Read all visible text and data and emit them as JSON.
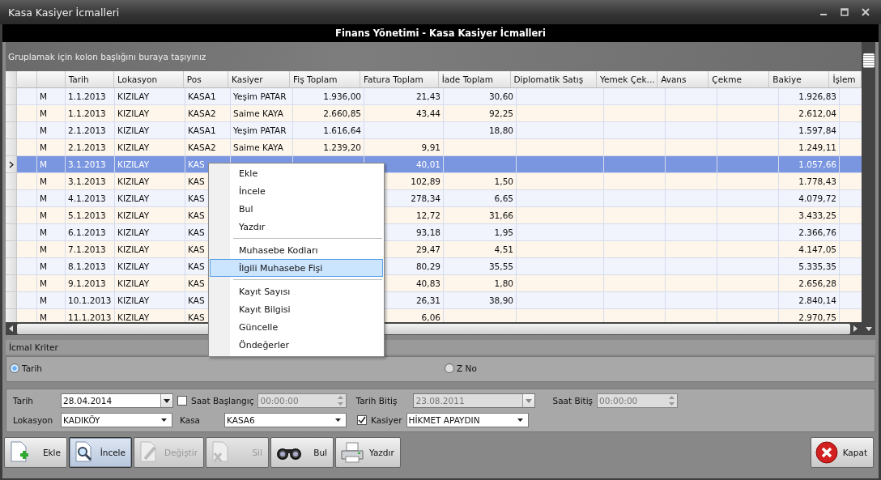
{
  "window": {
    "title": "Kasa Kasiyer İcmalleri"
  },
  "header": "Finans Yönetimi - Kasa Kasiyer İcmalleri",
  "group_panel_hint": "Gruplamak için kolon başlığını buraya taşıyınız",
  "table": {
    "columns": [
      null,
      "Tarih",
      "Lokasyon",
      "Pos",
      "Kasiyer",
      "Fiş Toplam",
      "Fatura Toplam",
      "İade Toplam",
      "Diplomatik Satış",
      "Yemek Çek...",
      "Avans",
      "Çekme",
      "Bakiye",
      "İşlem"
    ],
    "rows": [
      {
        "selected": false,
        "cells": [
          "M",
          "1.1.2013",
          "KIZILAY",
          "KASA1",
          "Yeşim PATAR",
          "1.936,00",
          "21,43",
          "30,60",
          null,
          null,
          null,
          null,
          "1.926,83",
          null
        ]
      },
      {
        "selected": false,
        "cells": [
          "M",
          "1.1.2013",
          "KIZILAY",
          "KASA2",
          "Saime KAYA",
          "2.660,85",
          "43,44",
          "92,25",
          null,
          null,
          null,
          null,
          "2.612,04",
          null
        ]
      },
      {
        "selected": false,
        "cells": [
          "M",
          "2.1.2013",
          "KIZILAY",
          "KASA1",
          "Yeşim PATAR",
          "1.616,64",
          null,
          "18,80",
          null,
          null,
          null,
          null,
          "1.597,84",
          null
        ]
      },
      {
        "selected": false,
        "cells": [
          "M",
          "2.1.2013",
          "KIZILAY",
          "KASA2",
          "Saime KAYA",
          "1.239,20",
          "9,91",
          null,
          null,
          null,
          null,
          null,
          "1.249,11",
          null
        ]
      },
      {
        "selected": true,
        "cells": [
          "M",
          "3.1.2013",
          "KIZILAY",
          "KAS",
          null,
          null,
          "40,01",
          null,
          null,
          null,
          null,
          null,
          "1.057,66",
          null
        ]
      },
      {
        "selected": false,
        "cells": [
          "M",
          "3.1.2013",
          "KIZILAY",
          "KAS",
          null,
          null,
          "102,89",
          "1,50",
          null,
          null,
          null,
          null,
          "1.778,43",
          null
        ]
      },
      {
        "selected": false,
        "cells": [
          "M",
          "4.1.2013",
          "KIZILAY",
          "KAS",
          null,
          null,
          "278,34",
          "6,65",
          null,
          null,
          null,
          null,
          "4.079,72",
          null
        ]
      },
      {
        "selected": false,
        "cells": [
          "M",
          "5.1.2013",
          "KIZILAY",
          "KAS",
          null,
          null,
          "12,72",
          "31,66",
          null,
          null,
          null,
          null,
          "3.433,25",
          null
        ]
      },
      {
        "selected": false,
        "cells": [
          "M",
          "6.1.2013",
          "KIZILAY",
          "KAS",
          null,
          null,
          "93,18",
          "1,95",
          null,
          null,
          null,
          null,
          "2.366,76",
          null
        ]
      },
      {
        "selected": false,
        "cells": [
          "M",
          "7.1.2013",
          "KIZILAY",
          "KAS",
          null,
          null,
          "29,47",
          "4,51",
          null,
          null,
          null,
          null,
          "4.147,05",
          null
        ]
      },
      {
        "selected": false,
        "cells": [
          "M",
          "8.1.2013",
          "KIZILAY",
          "KAS",
          null,
          null,
          "80,29",
          "35,55",
          null,
          null,
          null,
          null,
          "5.335,35",
          null
        ]
      },
      {
        "selected": false,
        "cells": [
          "M",
          "9.1.2013",
          "KIZILAY",
          "KAS",
          null,
          null,
          "40,83",
          "1,80",
          null,
          null,
          null,
          null,
          "2.656,28",
          null
        ]
      },
      {
        "selected": false,
        "cells": [
          "M",
          "10.1.2013",
          "KIZILAY",
          "KAS",
          null,
          null,
          "26,31",
          "38,90",
          null,
          null,
          null,
          null,
          "2.840,14",
          null
        ]
      },
      {
        "selected": false,
        "cells": [
          "M",
          "11.1.2013",
          "KIZILAY",
          "KAS",
          null,
          null,
          "6,06",
          null,
          null,
          null,
          null,
          null,
          "2.970,75",
          null
        ]
      }
    ]
  },
  "context_menu": {
    "groups": [
      [
        {
          "label": "Ekle",
          "selected": false
        },
        {
          "label": "İncele",
          "selected": false
        },
        {
          "label": "Bul",
          "selected": false
        },
        {
          "label": "Yazdır",
          "selected": false
        }
      ],
      [
        {
          "label": "Muhasebe Kodları",
          "selected": false
        },
        {
          "label": "İlgili Muhasebe Fişi",
          "selected": true
        }
      ],
      [
        {
          "label": "Kayıt Sayısı",
          "selected": false
        },
        {
          "label": "Kayıt Bilgisi",
          "selected": false
        },
        {
          "label": "Güncelle",
          "selected": false
        },
        {
          "label": "Öndeğerler",
          "selected": false
        }
      ]
    ]
  },
  "criteria": {
    "title": "İcmal Kriter",
    "options": [
      {
        "label": "Tarih",
        "selected": true
      },
      {
        "label": "Z No",
        "selected": false
      }
    ]
  },
  "filters": {
    "tarih": {
      "label": "Tarih",
      "value": "28.04.2014"
    },
    "saat_baslangic": {
      "label": "Saat Başlangıç",
      "checked": false,
      "value": "00:00:00",
      "disabled": true
    },
    "tarih_bitis": {
      "label": "Tarih Bitiş",
      "value": "23.08.2011",
      "disabled": true
    },
    "saat_bitis": {
      "label": "Saat Bitiş",
      "value": "00:00:00",
      "disabled": true
    },
    "lokasyon": {
      "label": "Lokasyon",
      "value": "KADIKÖY"
    },
    "kasa": {
      "label": "Kasa",
      "value": "KASA6"
    },
    "kasiyer": {
      "label": "Kasiyer",
      "checked": true,
      "value": "HİKMET APAYDIN"
    }
  },
  "toolbar": [
    {
      "kind": "add",
      "label": "Ekle",
      "pressed": false,
      "disabled": false
    },
    {
      "kind": "view",
      "label": "İncele",
      "pressed": true,
      "disabled": false
    },
    {
      "kind": "edit",
      "label": "Değiştir",
      "pressed": false,
      "disabled": true
    },
    {
      "kind": "delete",
      "label": "Sil",
      "pressed": false,
      "disabled": true
    },
    {
      "kind": "find",
      "label": "Bul",
      "pressed": false,
      "disabled": false
    },
    {
      "kind": "print",
      "label": "Yazdır",
      "pressed": false,
      "disabled": false
    }
  ],
  "close_button": {
    "label": "Kapat"
  }
}
